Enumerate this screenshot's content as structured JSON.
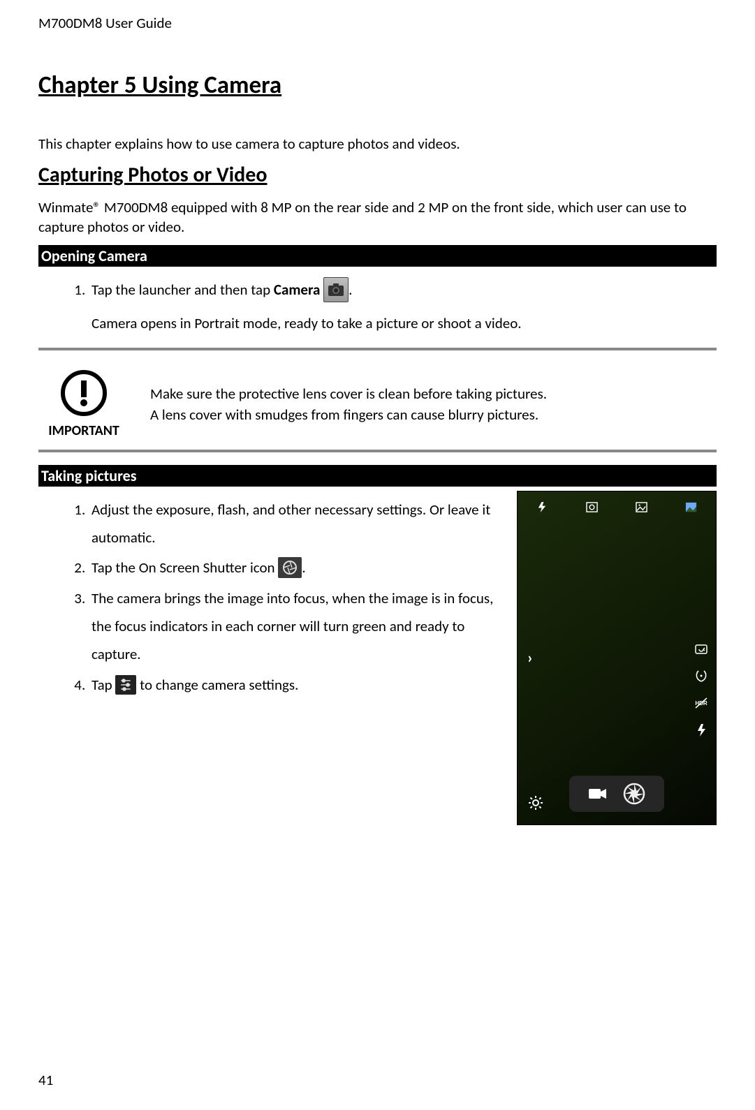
{
  "doc_header": "M700DM8 User Guide",
  "chapter_title": "Chapter 5 Using Camera",
  "chapter_intro": "This chapter explains how to use camera to capture photos and videos.",
  "section_title": "Capturing Photos or Video",
  "section_intro": "Winmate® M700DM8 equipped with 8 MP on the rear side and 2 MP on the front side, which user can use to capture photos or video.",
  "subsections": {
    "opening_camera_title": "Opening Camera",
    "opening_camera_steps": {
      "s1_pre": "Tap the launcher and then tap ",
      "s1_bold": "Camera ",
      "s1_post": ".",
      "s1_after": "Camera opens in Portrait mode, ready to take a picture or shoot a video."
    },
    "taking_pictures_title": "Taking pictures",
    "taking_steps": {
      "s1": "Adjust the exposure, flash, and other necessary settings. Or leave it automatic.",
      "s2_pre": "Tap the On Screen Shutter icon ",
      "s2_post": ".",
      "s3": "The camera brings the image into focus, when the image is in focus, the focus indicators in each corner will turn green and ready to capture.",
      "s4_pre": "Tap ",
      "s4_post": " to change camera settings."
    }
  },
  "important": {
    "label": "IMPORTANT",
    "line1": "Make sure the protective lens cover is clean before taking pictures.",
    "line2": "A lens cover with smudges from fingers can cause blurry pictures."
  },
  "icons": {
    "camera_app": "camera-icon",
    "shutter": "shutter-icon",
    "settings": "settings-icon",
    "important_badge": "important-icon",
    "phone_top": [
      "flash-icon",
      "face-detect-icon",
      "scene-icon",
      "gallery-icon"
    ],
    "phone_arrow": "›",
    "phone_side": [
      "switch-camera-icon",
      "timer-icon",
      "hdr-icon",
      "flash-icon"
    ],
    "phone_gear": "gear-icon",
    "phone_controls": [
      "video-icon",
      "shutter-icon"
    ]
  },
  "page_number": "41"
}
